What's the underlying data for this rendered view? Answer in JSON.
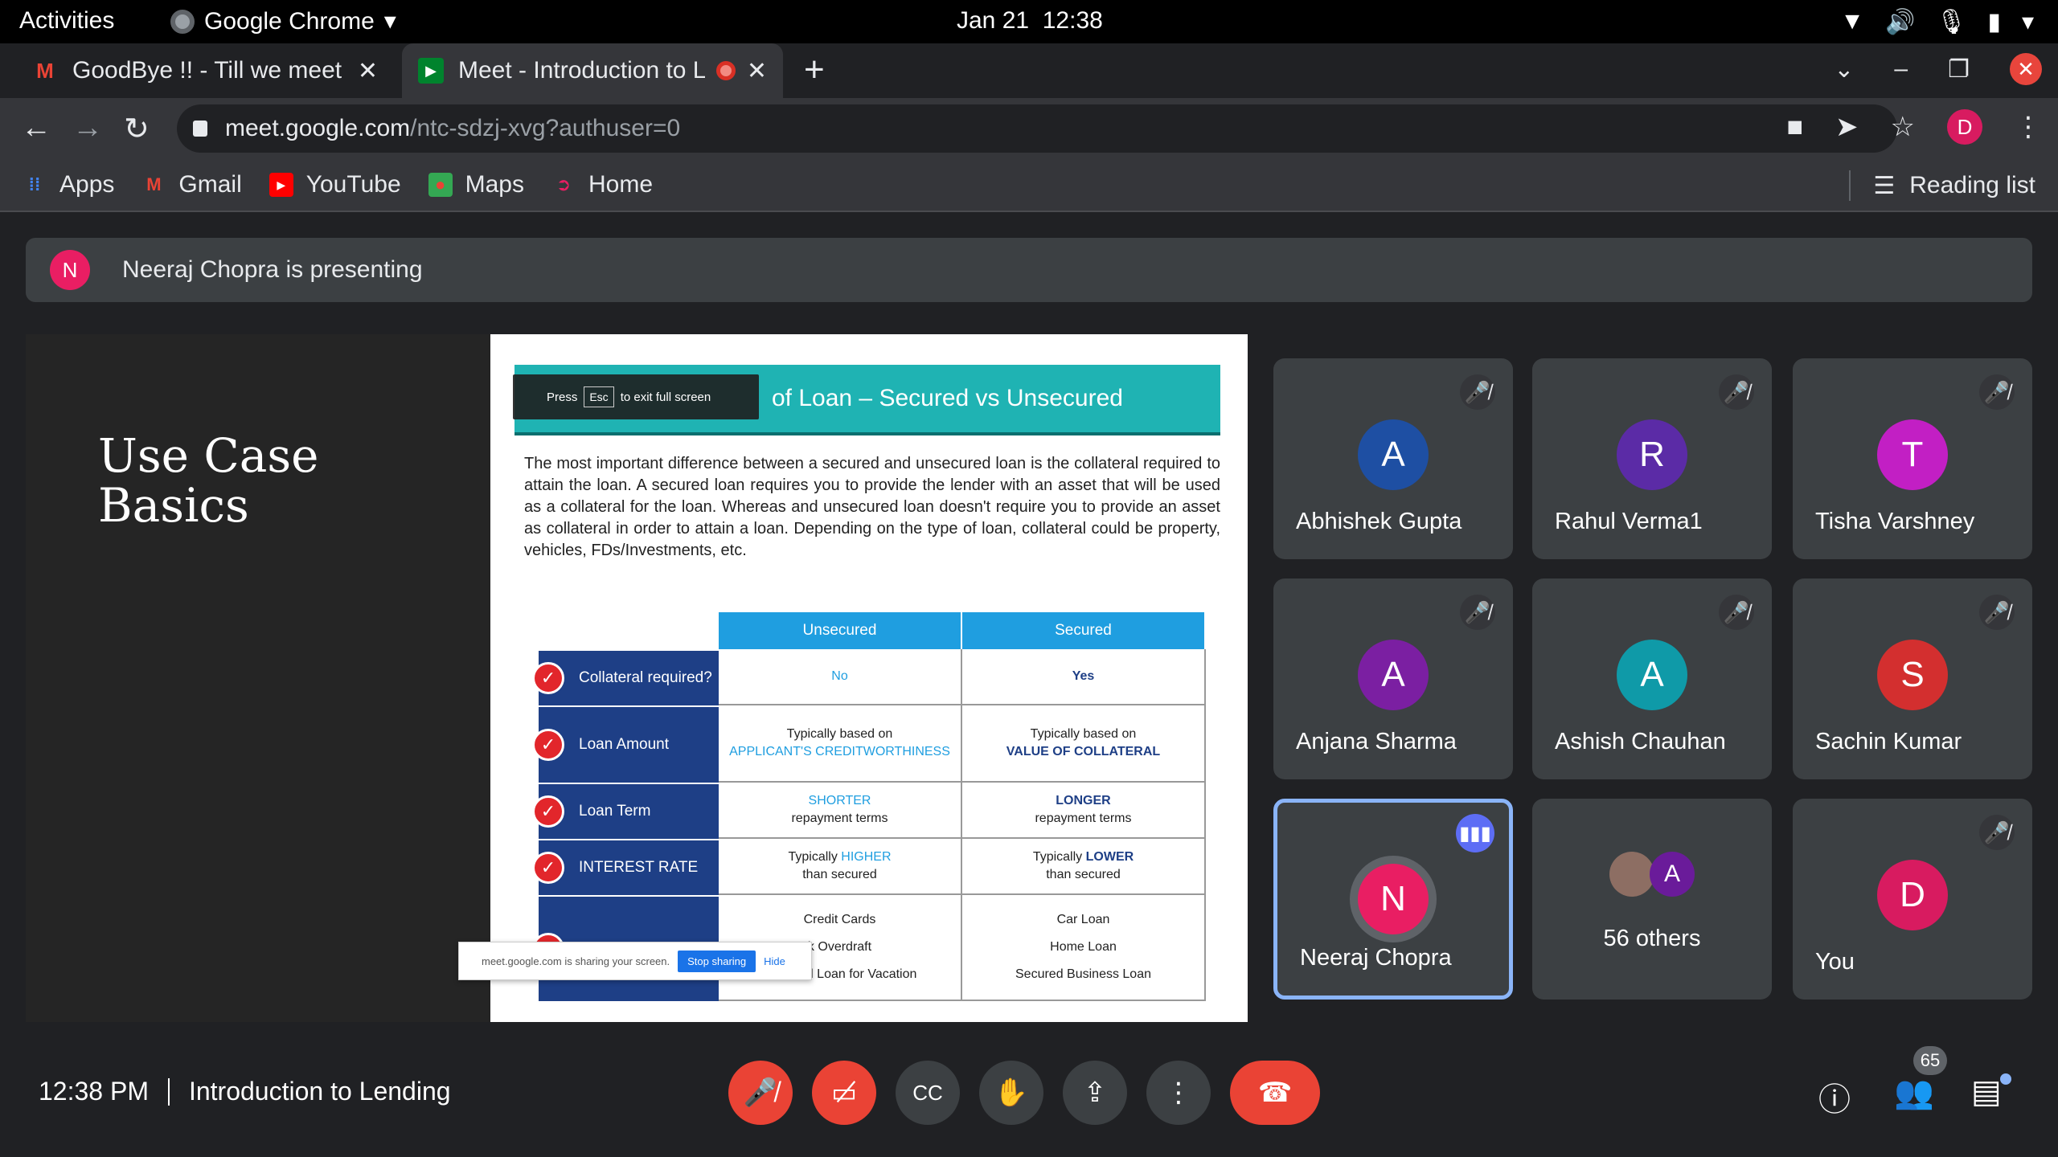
{
  "os": {
    "activities": "Activities",
    "app_name": "Google Chrome",
    "date": "Jan 21",
    "time": "12:38"
  },
  "browser": {
    "tabs": [
      {
        "title": "GoodBye !! - Till we meet again",
        "active": false
      },
      {
        "title": "Meet - Introduction to Lending",
        "active": true
      }
    ],
    "url_host": "meet.google.com",
    "url_path": "/ntc-sdzj-xvg?authuser=0",
    "profile_initial": "D",
    "bookmarks": [
      {
        "label": "Apps",
        "icon": "apps-grid-icon"
      },
      {
        "label": "Gmail",
        "icon": "gmail-icon"
      },
      {
        "label": "YouTube",
        "icon": "youtube-icon"
      },
      {
        "label": "Maps",
        "icon": "maps-icon"
      },
      {
        "label": "Home",
        "icon": "home-icon"
      }
    ],
    "reading_list": "Reading list"
  },
  "meet": {
    "presenter_initial": "N",
    "presenting_text": "Neeraj Chopra is presenting",
    "slide": {
      "left_title_line1": "Use Case",
      "left_title_line2": "Basics",
      "heading": "of Loan – Secured vs Unsecured",
      "esc_press": "Press",
      "esc_key": "Esc",
      "esc_rest": "to exit full screen",
      "paragraph": "The most important difference between a secured and unsecured loan is the collateral required to attain the loan. A secured loan requires you to provide the lender with an asset that will be used as a collateral for the loan. Whereas and unsecured loan doesn't require you to provide an asset as collateral in order to attain a loan. Depending on the type of loan, collateral could be property, vehicles, FDs/Investments, etc.",
      "table": {
        "col_unsecured": "Unsecured",
        "col_secured": "Secured",
        "rows": [
          {
            "label": "Collateral required?",
            "unsecured": "No",
            "secured": "Yes"
          },
          {
            "label": "Loan Amount",
            "unsecured_pre": "Typically based on",
            "unsecured_hl": "APPLICANT'S CREDITWORTHINESS",
            "secured_pre": "Typically based on",
            "secured_hl": "VALUE OF COLLATERAL"
          },
          {
            "label": "Loan Term",
            "unsecured_hl": "SHORTER",
            "unsecured_post": "repayment terms",
            "secured_hl": "LONGER",
            "secured_post": "repayment terms"
          },
          {
            "label": "INTEREST RATE",
            "unsecured_pre": "Typically",
            "unsecured_hl": "HIGHER",
            "unsecured_post": "than secured",
            "secured_pre": "Typically",
            "secured_hl": "LOWER",
            "secured_post": "than secured"
          },
          {
            "label": "",
            "unsecured_lines": [
              "Credit Cards",
              "k Overdraft",
              "Personal Loan for Vacation"
            ],
            "secured_lines": [
              "Car Loan",
              "Home Loan",
              "Secured Business Loan"
            ]
          }
        ]
      },
      "share_bar": {
        "text": "meet.google.com is sharing your screen.",
        "stop": "Stop sharing",
        "hide": "Hide"
      }
    },
    "participants": [
      {
        "name": "Abhishek Gupta",
        "initial": "A",
        "color": "#1e4fa3",
        "muted": true
      },
      {
        "name": "Rahul Verma1",
        "initial": "R",
        "color": "#5b2ba6",
        "muted": true
      },
      {
        "name": "Tisha Varshney",
        "initial": "T",
        "color": "#c21fc4",
        "muted": true
      },
      {
        "name": "Anjana Sharma",
        "initial": "A",
        "color": "#7b1fa2",
        "muted": true
      },
      {
        "name": "Ashish Chauhan",
        "initial": "A",
        "color": "#0f9aa8",
        "muted": true
      },
      {
        "name": "Sachin Kumar",
        "initial": "S",
        "color": "#d32f2f",
        "muted": true
      },
      {
        "name": "Neeraj Chopra",
        "initial": "N",
        "color": "#e91e63",
        "muted": false,
        "speaking": true
      },
      {
        "name": "56 others",
        "initial": "A",
        "color": "#6a1b9a",
        "group": true
      },
      {
        "name": "You",
        "initial": "D",
        "color": "#d81b60",
        "muted": true
      }
    ],
    "bottom": {
      "time": "12:38 PM",
      "meeting_title": "Introduction to Lending",
      "people_count": "65"
    }
  }
}
